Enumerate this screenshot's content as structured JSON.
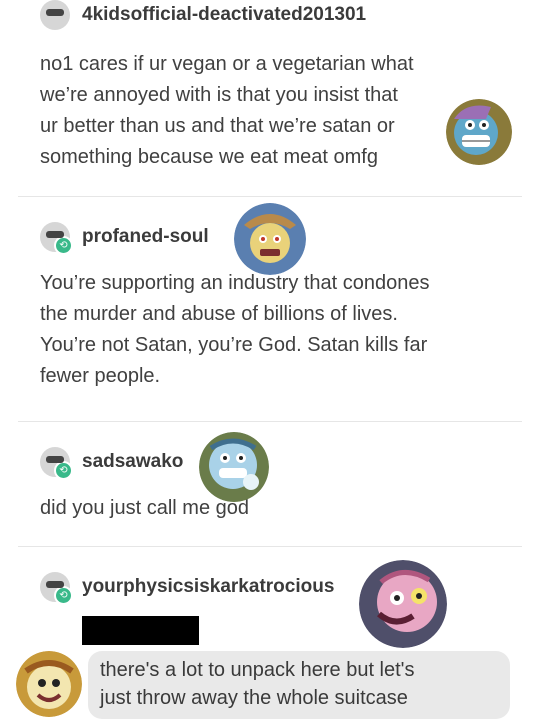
{
  "posts": [
    {
      "username": "4kidsofficial-deactivated201301",
      "lines": [
        "no1 cares if ur vegan or a vegetarian what",
        "we’re annoyed with is that you insist that",
        "ur better than us and that we’re satan or",
        "something because we eat meat omfg"
      ]
    },
    {
      "username": "profaned-soul",
      "lines": [
        "You’re supporting an industry that condones",
        "the murder and abuse of billions of lives.",
        "You’re not Satan, you’re God. Satan kills far",
        "fewer people."
      ]
    },
    {
      "username": "sadsawako",
      "lines": [
        "did you just call me god"
      ]
    },
    {
      "username": "yourphysicsiskarkatrocious",
      "lines": []
    }
  ],
  "reply": {
    "lines": [
      "there's a lot to unpack here but let's",
      "just throw away the whole suitcase"
    ]
  },
  "colors": {
    "reblog_badge": "#39b98a",
    "bubble": "#e9e9e9"
  },
  "icons": {
    "reblog": "reblog-icon",
    "avatar": "avatar"
  }
}
